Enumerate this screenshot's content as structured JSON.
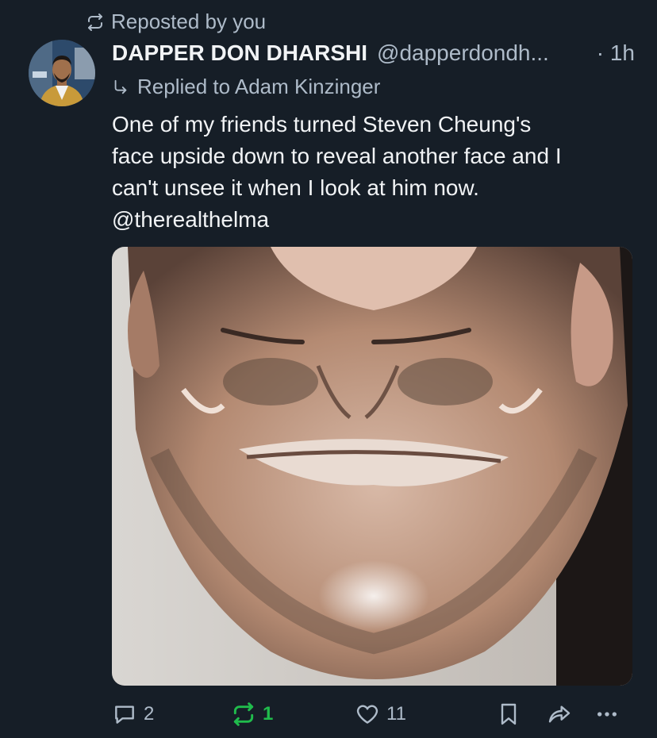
{
  "repost": {
    "label": "Reposted by you",
    "icon": "repost-icon"
  },
  "author": {
    "name": "DAPPER DON DHARSHI",
    "handle": "@dapperdondh...",
    "time": "1h"
  },
  "reply": {
    "label": "Replied to Adam Kinzinger",
    "icon": "reply-arrow-icon"
  },
  "post": {
    "text": "One of my friends turned Steven Cheung's\nface upside down to reveal another face and I\ncan't unsee it when I look at him now.\n @therealthelma"
  },
  "actions": {
    "reply_count": "2",
    "repost_count": "1",
    "like_count": "11"
  },
  "colors": {
    "background": "#161e27",
    "muted_text": "#aebbc9",
    "repost_active": "#20bc4c"
  }
}
